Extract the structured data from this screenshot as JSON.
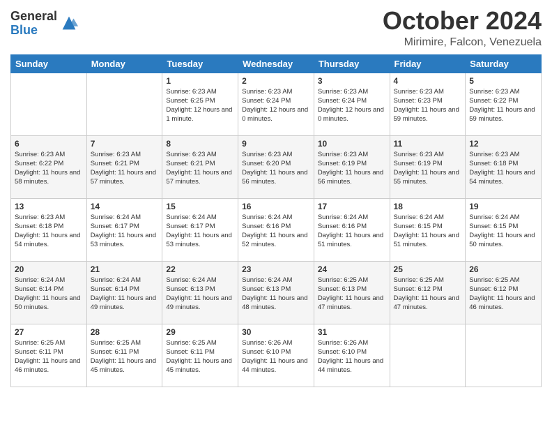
{
  "header": {
    "logo": {
      "general": "General",
      "blue": "Blue"
    },
    "month": "October 2024",
    "location": "Mirimire, Falcon, Venezuela"
  },
  "weekdays": [
    "Sunday",
    "Monday",
    "Tuesday",
    "Wednesday",
    "Thursday",
    "Friday",
    "Saturday"
  ],
  "weeks": [
    [
      {
        "day": "",
        "sunrise": "",
        "sunset": "",
        "daylight": ""
      },
      {
        "day": "",
        "sunrise": "",
        "sunset": "",
        "daylight": ""
      },
      {
        "day": "1",
        "sunrise": "Sunrise: 6:23 AM",
        "sunset": "Sunset: 6:25 PM",
        "daylight": "Daylight: 12 hours and 1 minute."
      },
      {
        "day": "2",
        "sunrise": "Sunrise: 6:23 AM",
        "sunset": "Sunset: 6:24 PM",
        "daylight": "Daylight: 12 hours and 0 minutes."
      },
      {
        "day": "3",
        "sunrise": "Sunrise: 6:23 AM",
        "sunset": "Sunset: 6:24 PM",
        "daylight": "Daylight: 12 hours and 0 minutes."
      },
      {
        "day": "4",
        "sunrise": "Sunrise: 6:23 AM",
        "sunset": "Sunset: 6:23 PM",
        "daylight": "Daylight: 11 hours and 59 minutes."
      },
      {
        "day": "5",
        "sunrise": "Sunrise: 6:23 AM",
        "sunset": "Sunset: 6:22 PM",
        "daylight": "Daylight: 11 hours and 59 minutes."
      }
    ],
    [
      {
        "day": "6",
        "sunrise": "Sunrise: 6:23 AM",
        "sunset": "Sunset: 6:22 PM",
        "daylight": "Daylight: 11 hours and 58 minutes."
      },
      {
        "day": "7",
        "sunrise": "Sunrise: 6:23 AM",
        "sunset": "Sunset: 6:21 PM",
        "daylight": "Daylight: 11 hours and 57 minutes."
      },
      {
        "day": "8",
        "sunrise": "Sunrise: 6:23 AM",
        "sunset": "Sunset: 6:21 PM",
        "daylight": "Daylight: 11 hours and 57 minutes."
      },
      {
        "day": "9",
        "sunrise": "Sunrise: 6:23 AM",
        "sunset": "Sunset: 6:20 PM",
        "daylight": "Daylight: 11 hours and 56 minutes."
      },
      {
        "day": "10",
        "sunrise": "Sunrise: 6:23 AM",
        "sunset": "Sunset: 6:19 PM",
        "daylight": "Daylight: 11 hours and 56 minutes."
      },
      {
        "day": "11",
        "sunrise": "Sunrise: 6:23 AM",
        "sunset": "Sunset: 6:19 PM",
        "daylight": "Daylight: 11 hours and 55 minutes."
      },
      {
        "day": "12",
        "sunrise": "Sunrise: 6:23 AM",
        "sunset": "Sunset: 6:18 PM",
        "daylight": "Daylight: 11 hours and 54 minutes."
      }
    ],
    [
      {
        "day": "13",
        "sunrise": "Sunrise: 6:23 AM",
        "sunset": "Sunset: 6:18 PM",
        "daylight": "Daylight: 11 hours and 54 minutes."
      },
      {
        "day": "14",
        "sunrise": "Sunrise: 6:24 AM",
        "sunset": "Sunset: 6:17 PM",
        "daylight": "Daylight: 11 hours and 53 minutes."
      },
      {
        "day": "15",
        "sunrise": "Sunrise: 6:24 AM",
        "sunset": "Sunset: 6:17 PM",
        "daylight": "Daylight: 11 hours and 53 minutes."
      },
      {
        "day": "16",
        "sunrise": "Sunrise: 6:24 AM",
        "sunset": "Sunset: 6:16 PM",
        "daylight": "Daylight: 11 hours and 52 minutes."
      },
      {
        "day": "17",
        "sunrise": "Sunrise: 6:24 AM",
        "sunset": "Sunset: 6:16 PM",
        "daylight": "Daylight: 11 hours and 51 minutes."
      },
      {
        "day": "18",
        "sunrise": "Sunrise: 6:24 AM",
        "sunset": "Sunset: 6:15 PM",
        "daylight": "Daylight: 11 hours and 51 minutes."
      },
      {
        "day": "19",
        "sunrise": "Sunrise: 6:24 AM",
        "sunset": "Sunset: 6:15 PM",
        "daylight": "Daylight: 11 hours and 50 minutes."
      }
    ],
    [
      {
        "day": "20",
        "sunrise": "Sunrise: 6:24 AM",
        "sunset": "Sunset: 6:14 PM",
        "daylight": "Daylight: 11 hours and 50 minutes."
      },
      {
        "day": "21",
        "sunrise": "Sunrise: 6:24 AM",
        "sunset": "Sunset: 6:14 PM",
        "daylight": "Daylight: 11 hours and 49 minutes."
      },
      {
        "day": "22",
        "sunrise": "Sunrise: 6:24 AM",
        "sunset": "Sunset: 6:13 PM",
        "daylight": "Daylight: 11 hours and 49 minutes."
      },
      {
        "day": "23",
        "sunrise": "Sunrise: 6:24 AM",
        "sunset": "Sunset: 6:13 PM",
        "daylight": "Daylight: 11 hours and 48 minutes."
      },
      {
        "day": "24",
        "sunrise": "Sunrise: 6:25 AM",
        "sunset": "Sunset: 6:13 PM",
        "daylight": "Daylight: 11 hours and 47 minutes."
      },
      {
        "day": "25",
        "sunrise": "Sunrise: 6:25 AM",
        "sunset": "Sunset: 6:12 PM",
        "daylight": "Daylight: 11 hours and 47 minutes."
      },
      {
        "day": "26",
        "sunrise": "Sunrise: 6:25 AM",
        "sunset": "Sunset: 6:12 PM",
        "daylight": "Daylight: 11 hours and 46 minutes."
      }
    ],
    [
      {
        "day": "27",
        "sunrise": "Sunrise: 6:25 AM",
        "sunset": "Sunset: 6:11 PM",
        "daylight": "Daylight: 11 hours and 46 minutes."
      },
      {
        "day": "28",
        "sunrise": "Sunrise: 6:25 AM",
        "sunset": "Sunset: 6:11 PM",
        "daylight": "Daylight: 11 hours and 45 minutes."
      },
      {
        "day": "29",
        "sunrise": "Sunrise: 6:25 AM",
        "sunset": "Sunset: 6:11 PM",
        "daylight": "Daylight: 11 hours and 45 minutes."
      },
      {
        "day": "30",
        "sunrise": "Sunrise: 6:26 AM",
        "sunset": "Sunset: 6:10 PM",
        "daylight": "Daylight: 11 hours and 44 minutes."
      },
      {
        "day": "31",
        "sunrise": "Sunrise: 6:26 AM",
        "sunset": "Sunset: 6:10 PM",
        "daylight": "Daylight: 11 hours and 44 minutes."
      },
      {
        "day": "",
        "sunrise": "",
        "sunset": "",
        "daylight": ""
      },
      {
        "day": "",
        "sunrise": "",
        "sunset": "",
        "daylight": ""
      }
    ]
  ]
}
